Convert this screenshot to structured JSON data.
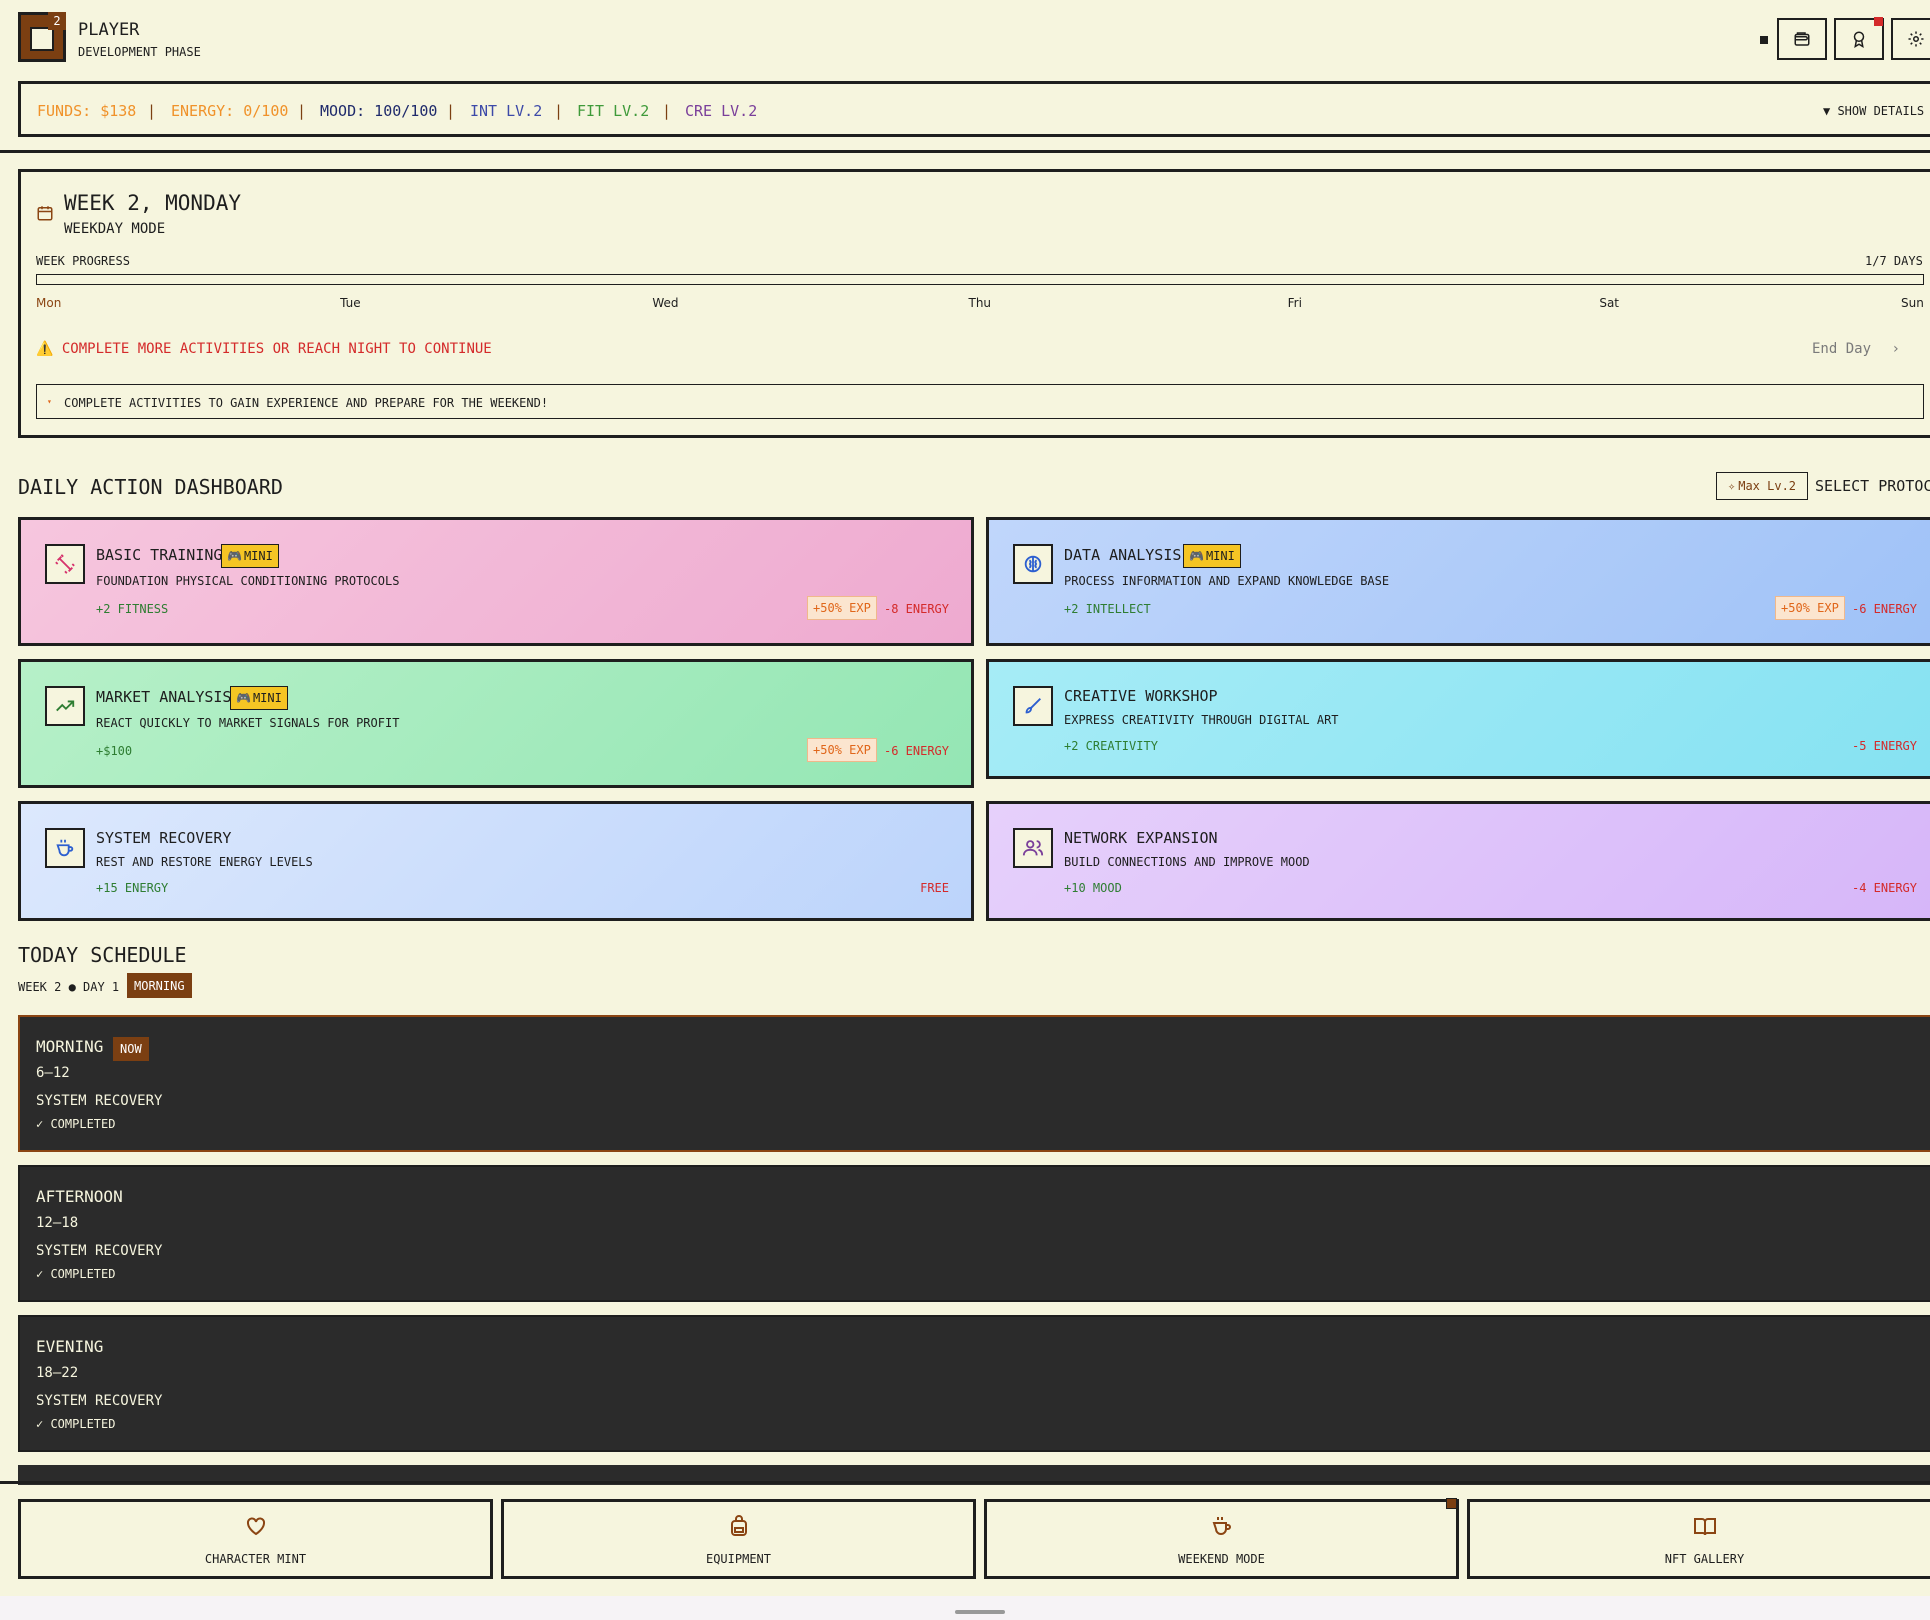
{
  "header": {
    "avatar_level": "2",
    "player_name": "PLAYER",
    "phase": "DEVELOPMENT PHASE",
    "buttons": [
      "wallet-icon",
      "award-icon",
      "settings-icon"
    ]
  },
  "stats": {
    "funds": "FUNDS: $138",
    "energy": "ENERGY: 0/100",
    "mood": "MOOD: 100/100",
    "int": "INT LV.2",
    "fit": "FIT LV.2",
    "cre": "CRE LV.2",
    "separator": "|",
    "show_details": "▼ SHOW DETAILS",
    "colors": {
      "funds": "#f0922a",
      "energy": "#f0922a",
      "mood": "#1f2a6b",
      "int": "#3d4aa8",
      "fit": "#3f9a3a",
      "cre": "#7a3f9a"
    }
  },
  "week": {
    "title": "WEEK 2, MONDAY",
    "mode": "WEEKDAY MODE",
    "progress_label": "WEEK PROGRESS",
    "progress_days": "1/7 DAYS",
    "progress_fraction": 0,
    "days": [
      "Mon",
      "Tue",
      "Wed",
      "Thu",
      "Fri",
      "Sat",
      "Sun"
    ],
    "active_day": "Mon",
    "warning": "⚠️ COMPLETE MORE ACTIVITIES OR REACH NIGHT TO CONTINUE",
    "end_day": "End Day",
    "tip": "COMPLETE ACTIVITIES TO GAIN EXPERIENCE AND PREPARE FOR THE WEEKEND!"
  },
  "dashboard": {
    "title": "DAILY ACTION DASHBOARD",
    "max_level": "Max Lv.2",
    "select_protocol": "SELECT PROTOCOL",
    "mini_label": "MINI",
    "exp_label": "+50% EXP",
    "cards": [
      {
        "title": "BASIC TRAINING",
        "desc": "FOUNDATION PHYSICAL CONDITIONING PROTOCOLS",
        "effect": "+2 FITNESS",
        "cost": "-8 ENERGY",
        "icon": "dumbbell-icon",
        "mini": true,
        "exp": true
      },
      {
        "title": "DATA ANALYSIS",
        "desc": "PROCESS INFORMATION AND EXPAND KNOWLEDGE BASE",
        "effect": "+2 INTELLECT",
        "cost": "-6 ENERGY",
        "icon": "brain-icon",
        "mini": true,
        "exp": true
      },
      {
        "title": "MARKET ANALYSIS",
        "desc": "REACT QUICKLY TO MARKET SIGNALS FOR PROFIT",
        "effect": "+$100",
        "cost": "-6 ENERGY",
        "icon": "trending-up-icon",
        "mini": true,
        "exp": true
      },
      {
        "title": "CREATIVE WORKSHOP",
        "desc": "EXPRESS CREATIVITY THROUGH DIGITAL ART",
        "effect": "+2 CREATIVITY",
        "cost": "-5 ENERGY",
        "icon": "brush-icon",
        "mini": false,
        "exp": false
      },
      {
        "title": "SYSTEM RECOVERY",
        "desc": "REST AND RESTORE ENERGY LEVELS",
        "effect": "+15 ENERGY",
        "cost": "FREE",
        "icon": "coffee-icon",
        "mini": false,
        "exp": false
      },
      {
        "title": "NETWORK EXPANSION",
        "desc": "BUILD CONNECTIONS AND IMPROVE MOOD",
        "effect": "+10 MOOD",
        "cost": "-4 ENERGY",
        "icon": "users-icon",
        "mini": false,
        "exp": false
      }
    ]
  },
  "schedule": {
    "title": "TODAY SCHEDULE",
    "subtitle": "WEEK 2 ● DAY 1",
    "current_badge": "MORNING",
    "now_label": "NOW",
    "slots": [
      {
        "name": "MORNING",
        "time": "6–12",
        "activity": "SYSTEM RECOVERY",
        "status": "✓ COMPLETED"
      },
      {
        "name": "AFTERNOON",
        "time": "12–18",
        "activity": "SYSTEM RECOVERY",
        "status": "✓ COMPLETED"
      },
      {
        "name": "EVENING",
        "time": "18–22",
        "activity": "SYSTEM RECOVERY",
        "status": "✓ COMPLETED"
      }
    ]
  },
  "nav": {
    "items": [
      {
        "label": "CHARACTER MINT",
        "icon": "heart-icon"
      },
      {
        "label": "EQUIPMENT",
        "icon": "backpack-icon"
      },
      {
        "label": "WEEKEND MODE",
        "icon": "coffee-icon"
      },
      {
        "label": "NFT GALLERY",
        "icon": "book-open-icon"
      }
    ]
  }
}
